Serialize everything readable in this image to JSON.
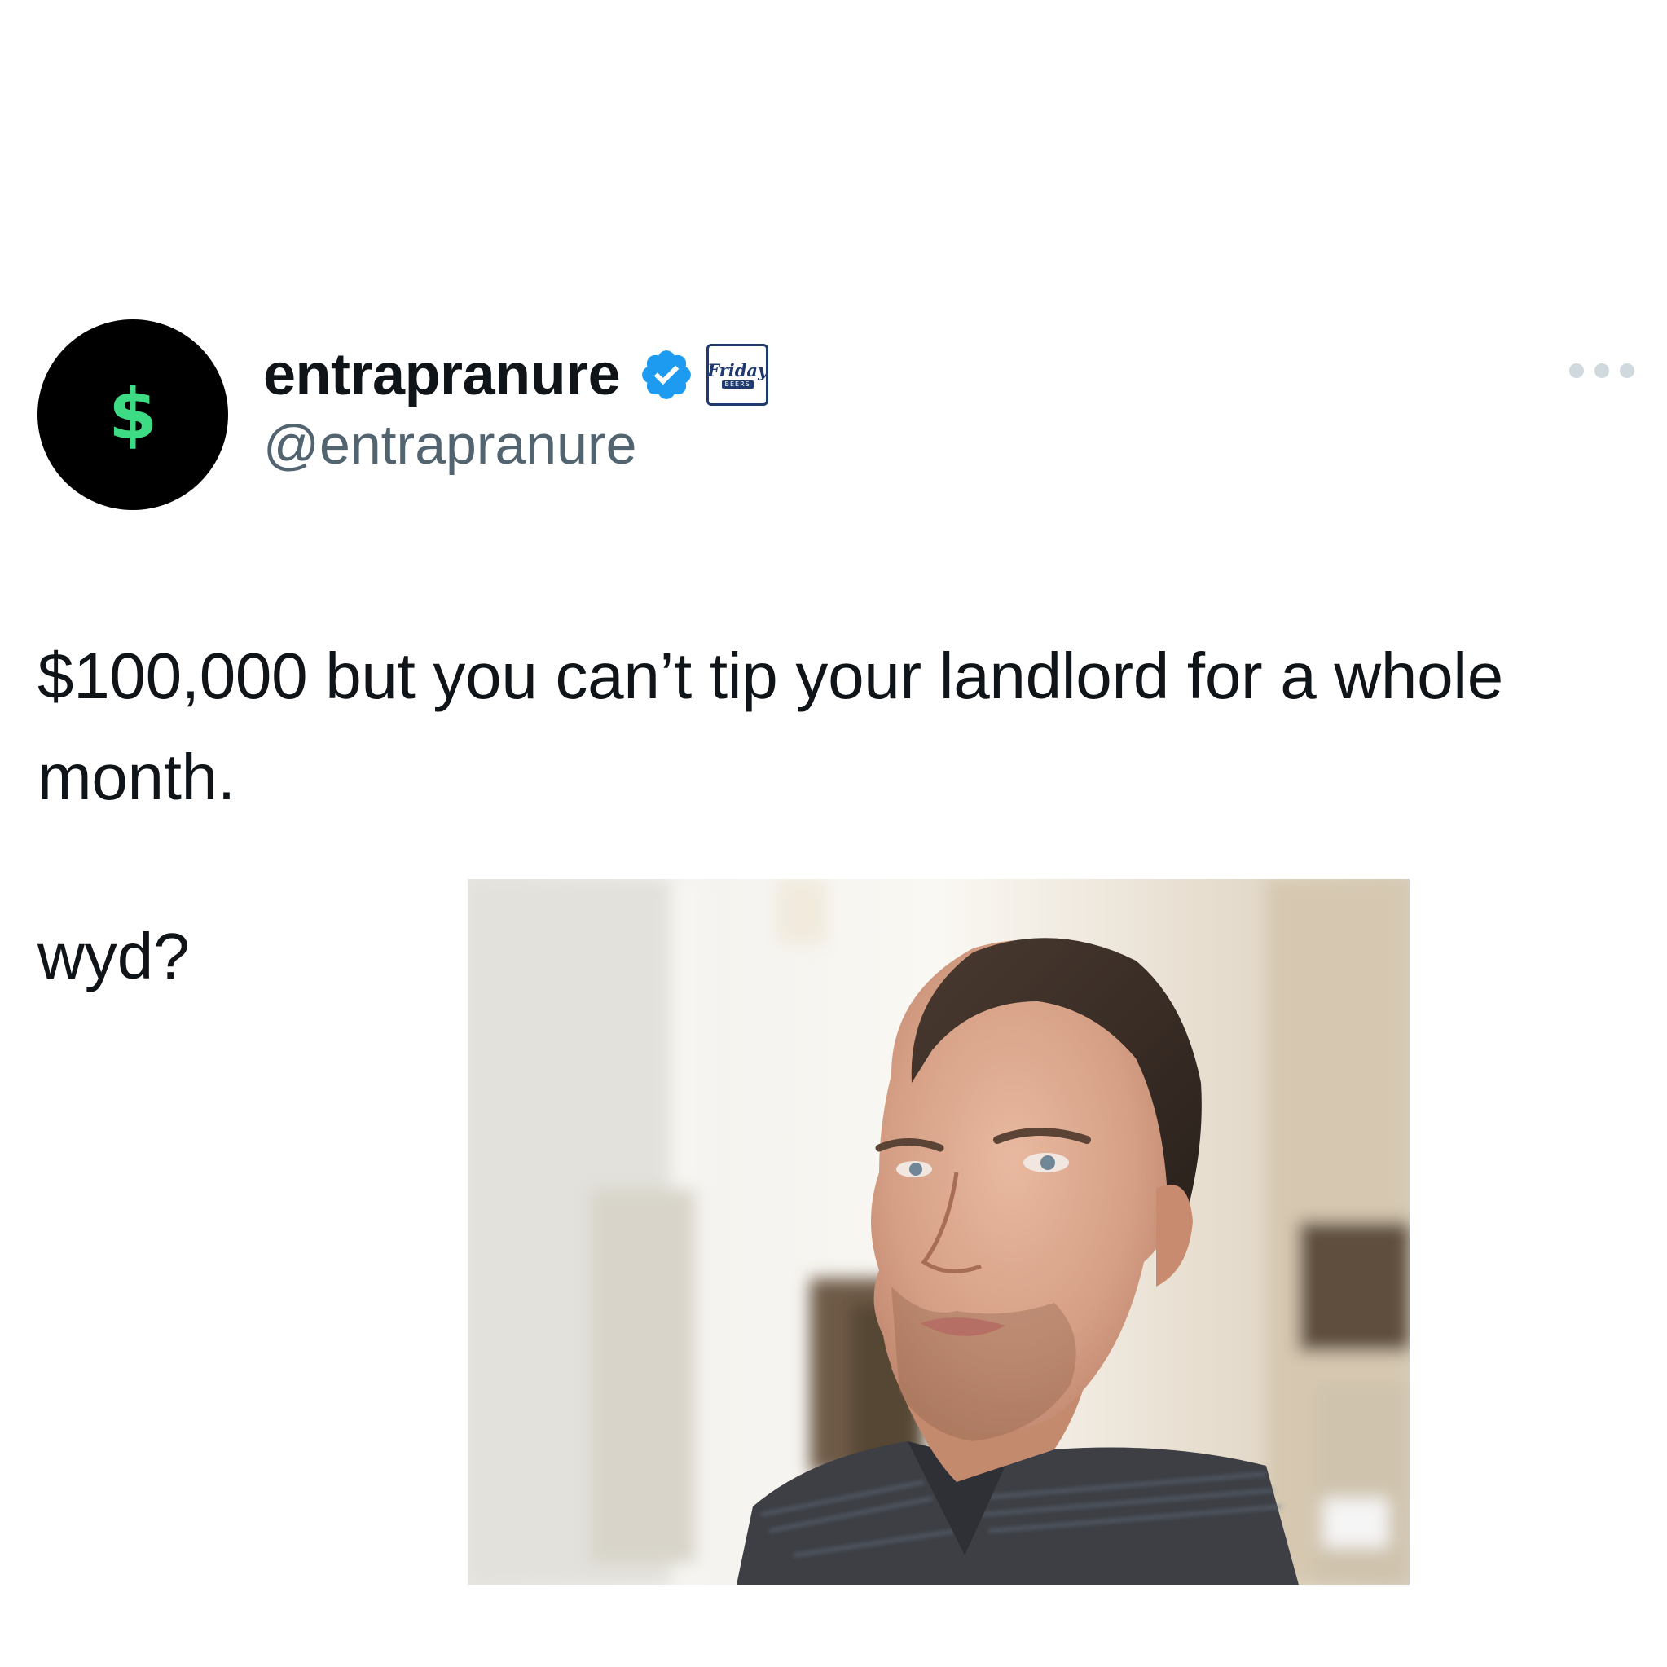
{
  "tweet": {
    "author": {
      "avatar_glyph": "$",
      "display_name": "entrapranure",
      "handle": "@entrapranure",
      "verified": true,
      "affiliate_badge": {
        "brand": "Friday",
        "sub": "BEERS"
      }
    },
    "text_line": "$100,000 but you can’t tip your landlord for a whole month.",
    "followup": "wyd?",
    "media": {
      "kind": "photo"
    }
  },
  "colors": {
    "avatar_background": "#000000",
    "avatar_glyph": "#3ddc84",
    "verified_badge": "#1d9bf0",
    "handle": "#536471",
    "text": "#0f1419",
    "more_dots": "#cfd9de",
    "affiliate_border": "#1e3a6e"
  },
  "icons": {
    "verified": "verified-check-icon",
    "more": "more-horizontal-icon"
  }
}
